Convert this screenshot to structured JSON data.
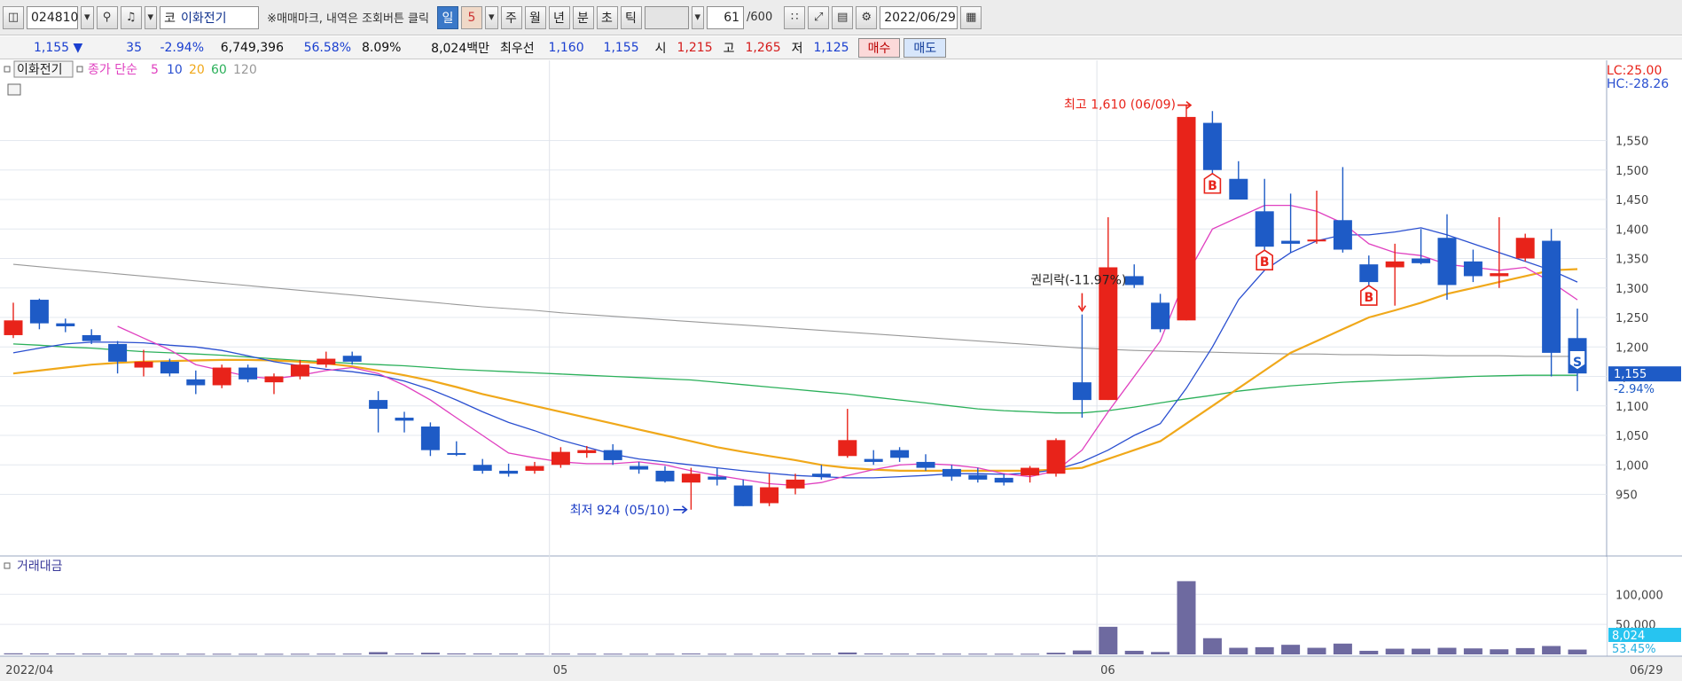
{
  "toolbar": {
    "code": "024810",
    "market_tag": "코",
    "stock_name": "이화전기",
    "hint": "※매매마크, 내역은 조회버튼 클릭",
    "periods": [
      "일",
      "5",
      "주",
      "월",
      "년",
      "분",
      "초",
      "틱"
    ],
    "active_period": "일",
    "selected_period": "5",
    "count": "61",
    "total": "/600",
    "date": "2022/06/29",
    "icons": [
      "chart-type-icon",
      "search-icon",
      "sound-icon",
      "scatter-icon",
      "compare-icon",
      "save-icon",
      "settings-icon",
      "calendar-icon"
    ]
  },
  "quote": {
    "price": "1,155 ▼",
    "change": "35",
    "change_pct": "-2.94%",
    "volume": "6,749,396",
    "vol_ratio": "56.58%",
    "turnover_pct": "8.09%",
    "amount": "8,024백만",
    "best_bid_label": "최우선",
    "best_ask": "1,160",
    "best_bid": "1,155",
    "open_label": "시",
    "open": "1,215",
    "high_label": "고",
    "high": "1,265",
    "low_label": "저",
    "low": "1,125",
    "buy_label": "매수",
    "sell_label": "매도"
  },
  "colors": {
    "up": "#e8231a",
    "down": "#1e5bc6",
    "ma5": "#e040c0",
    "ma10": "#2a4fd0",
    "ma20": "#f0a81a",
    "ma60": "#2bb05a",
    "ma120": "#999999",
    "volume_bar": "#6e6aa0"
  },
  "chart_data": {
    "type": "candlestick",
    "legend": {
      "name": "이화전기",
      "ma_label": "종가 단순",
      "ma_periods": [
        "5",
        "10",
        "20",
        "60",
        "120"
      ]
    },
    "right_labels": {
      "lc": "LC:25.00",
      "hc": "HC:-28.26"
    },
    "ylim": [
      850,
      1650
    ],
    "y_ticks": [
      950,
      1000,
      1050,
      1100,
      1150,
      1200,
      1250,
      1300,
      1350,
      1400,
      1450,
      1500,
      1550
    ],
    "y_tick_labels": [
      "950",
      "1,000",
      "1,050",
      "1,100",
      "1,150",
      "1,200",
      "1,250",
      "1,300",
      "1,350",
      "1,400",
      "1,450",
      "1,500",
      "1,550"
    ],
    "x_labels": [
      {
        "label": "2022/04",
        "index": 0
      },
      {
        "label": "05",
        "index": 21
      },
      {
        "label": "06",
        "index": 42
      }
    ],
    "last_x_label": "06/29",
    "candles": [
      {
        "o": 1220,
        "h": 1275,
        "l": 1215,
        "c": 1245
      },
      {
        "o": 1280,
        "h": 1282,
        "l": 1230,
        "c": 1240
      },
      {
        "o": 1240,
        "h": 1248,
        "l": 1225,
        "c": 1235
      },
      {
        "o": 1220,
        "h": 1230,
        "l": 1205,
        "c": 1210
      },
      {
        "o": 1205,
        "h": 1210,
        "l": 1155,
        "c": 1175
      },
      {
        "o": 1165,
        "h": 1195,
        "l": 1150,
        "c": 1175
      },
      {
        "o": 1175,
        "h": 1180,
        "l": 1150,
        "c": 1155
      },
      {
        "o": 1145,
        "h": 1160,
        "l": 1120,
        "c": 1135
      },
      {
        "o": 1135,
        "h": 1170,
        "l": 1130,
        "c": 1165
      },
      {
        "o": 1165,
        "h": 1170,
        "l": 1140,
        "c": 1145
      },
      {
        "o": 1140,
        "h": 1155,
        "l": 1120,
        "c": 1150
      },
      {
        "o": 1150,
        "h": 1178,
        "l": 1145,
        "c": 1170
      },
      {
        "o": 1170,
        "h": 1192,
        "l": 1165,
        "c": 1180
      },
      {
        "o": 1185,
        "h": 1192,
        "l": 1170,
        "c": 1175
      },
      {
        "o": 1110,
        "h": 1125,
        "l": 1055,
        "c": 1095
      },
      {
        "o": 1080,
        "h": 1090,
        "l": 1055,
        "c": 1075
      },
      {
        "o": 1065,
        "h": 1072,
        "l": 1015,
        "c": 1025
      },
      {
        "o": 1020,
        "h": 1040,
        "l": 1015,
        "c": 1018
      },
      {
        "o": 1000,
        "h": 1010,
        "l": 985,
        "c": 990
      },
      {
        "o": 990,
        "h": 1002,
        "l": 980,
        "c": 985
      },
      {
        "o": 990,
        "h": 1005,
        "l": 985,
        "c": 998
      },
      {
        "o": 1000,
        "h": 1030,
        "l": 995,
        "c": 1022
      },
      {
        "o": 1020,
        "h": 1032,
        "l": 1012,
        "c": 1025
      },
      {
        "o": 1025,
        "h": 1035,
        "l": 1000,
        "c": 1008
      },
      {
        "o": 998,
        "h": 1005,
        "l": 985,
        "c": 992
      },
      {
        "o": 990,
        "h": 998,
        "l": 970,
        "c": 972
      },
      {
        "o": 970,
        "h": 995,
        "l": 924,
        "c": 985
      },
      {
        "o": 980,
        "h": 995,
        "l": 965,
        "c": 975
      },
      {
        "o": 965,
        "h": 975,
        "l": 930,
        "c": 930
      },
      {
        "o": 935,
        "h": 985,
        "l": 930,
        "c": 962
      },
      {
        "o": 960,
        "h": 985,
        "l": 950,
        "c": 975
      },
      {
        "o": 985,
        "h": 1000,
        "l": 975,
        "c": 980
      },
      {
        "o": 1015,
        "h": 1095,
        "l": 1012,
        "c": 1042
      },
      {
        "o": 1010,
        "h": 1025,
        "l": 1000,
        "c": 1005
      },
      {
        "o": 1025,
        "h": 1030,
        "l": 1005,
        "c": 1012
      },
      {
        "o": 1005,
        "h": 1018,
        "l": 990,
        "c": 995
      },
      {
        "o": 993,
        "h": 1000,
        "l": 973,
        "c": 980
      },
      {
        "o": 983,
        "h": 995,
        "l": 970,
        "c": 975
      },
      {
        "o": 978,
        "h": 985,
        "l": 965,
        "c": 970
      },
      {
        "o": 982,
        "h": 998,
        "l": 970,
        "c": 995
      },
      {
        "o": 985,
        "h": 1045,
        "l": 980,
        "c": 1042
      },
      {
        "o": 1140,
        "h": 1255,
        "l": 1080,
        "c": 1110
      },
      {
        "o": 1110,
        "h": 1420,
        "l": 1110,
        "c": 1335
      },
      {
        "o": 1320,
        "h": 1340,
        "l": 1300,
        "c": 1305
      },
      {
        "o": 1275,
        "h": 1290,
        "l": 1225,
        "c": 1230
      },
      {
        "o": 1245,
        "h": 1610,
        "l": 1245,
        "c": 1590
      },
      {
        "o": 1580,
        "h": 1600,
        "l": 1480,
        "c": 1500
      },
      {
        "o": 1485,
        "h": 1515,
        "l": 1450,
        "c": 1450
      },
      {
        "o": 1430,
        "h": 1485,
        "l": 1360,
        "c": 1370
      },
      {
        "o": 1380,
        "h": 1460,
        "l": 1360,
        "c": 1375
      },
      {
        "o": 1380,
        "h": 1465,
        "l": 1375,
        "c": 1382
      },
      {
        "o": 1415,
        "h": 1505,
        "l": 1360,
        "c": 1365
      },
      {
        "o": 1340,
        "h": 1355,
        "l": 1300,
        "c": 1310
      },
      {
        "o": 1335,
        "h": 1375,
        "l": 1270,
        "c": 1345
      },
      {
        "o": 1350,
        "h": 1400,
        "l": 1340,
        "c": 1342
      },
      {
        "o": 1385,
        "h": 1425,
        "l": 1280,
        "c": 1305
      },
      {
        "o": 1345,
        "h": 1365,
        "l": 1310,
        "c": 1320
      },
      {
        "o": 1320,
        "h": 1420,
        "l": 1300,
        "c": 1325
      },
      {
        "o": 1350,
        "h": 1392,
        "l": 1345,
        "c": 1385
      },
      {
        "o": 1380,
        "h": 1400,
        "l": 1150,
        "c": 1190
      },
      {
        "o": 1215,
        "h": 1265,
        "l": 1125,
        "c": 1155
      }
    ],
    "ma_series": [
      {
        "period": "5",
        "values": [
          null,
          null,
          null,
          null,
          1235,
          1215,
          1195,
          1170,
          1160,
          1150,
          1146,
          1152,
          1160,
          1165,
          1155,
          1135,
          1110,
          1080,
          1050,
          1020,
          1012,
          1005,
          1002,
          1002,
          1005,
          1000,
          990,
          982,
          975,
          968,
          965,
          970,
          982,
          992,
          1000,
          1002,
          1000,
          995,
          985,
          980,
          990,
          1025,
          1090,
          1150,
          1210,
          1320,
          1400,
          1420,
          1440,
          1440,
          1430,
          1410,
          1375,
          1360,
          1355,
          1340,
          1335,
          1330,
          1335,
          1310,
          1280
        ]
      },
      {
        "period": "10",
        "values": [
          1190,
          1198,
          1205,
          1208,
          1208,
          1207,
          1203,
          1200,
          1194,
          1185,
          1175,
          1168,
          1162,
          1158,
          1152,
          1142,
          1128,
          1110,
          1090,
          1072,
          1058,
          1042,
          1030,
          1018,
          1010,
          1005,
          1000,
          995,
          990,
          986,
          982,
          980,
          978,
          978,
          980,
          982,
          985,
          985,
          984,
          986,
          992,
          1005,
          1025,
          1050,
          1070,
          1130,
          1200,
          1280,
          1330,
          1360,
          1380,
          1390,
          1390,
          1395,
          1402,
          1390,
          1375,
          1360,
          1345,
          1330,
          1310
        ]
      },
      {
        "period": "20",
        "values": [
          1155,
          1160,
          1165,
          1170,
          1173,
          1175,
          1176,
          1177,
          1178,
          1178,
          1177,
          1175,
          1172,
          1167,
          1160,
          1152,
          1143,
          1132,
          1120,
          1110,
          1100,
          1090,
          1080,
          1070,
          1060,
          1050,
          1040,
          1030,
          1022,
          1015,
          1008,
          1000,
          995,
          992,
          990,
          990,
          990,
          990,
          990,
          990,
          992,
          995,
          1010,
          1025,
          1040,
          1070,
          1100,
          1130,
          1160,
          1190,
          1210,
          1230,
          1250,
          1262,
          1275,
          1290,
          1300,
          1310,
          1320,
          1330,
          1332
        ]
      },
      {
        "period": "60",
        "values": [
          1205,
          1203,
          1200,
          1198,
          1195,
          1192,
          1190,
          1188,
          1186,
          1183,
          1180,
          1177,
          1175,
          1172,
          1170,
          1168,
          1165,
          1162,
          1160,
          1158,
          1156,
          1154,
          1152,
          1150,
          1148,
          1146,
          1144,
          1140,
          1136,
          1132,
          1128,
          1124,
          1120,
          1115,
          1110,
          1105,
          1100,
          1095,
          1092,
          1090,
          1088,
          1088,
          1092,
          1098,
          1105,
          1112,
          1118,
          1125,
          1130,
          1134,
          1137,
          1140,
          1142,
          1144,
          1146,
          1148,
          1150,
          1151,
          1152,
          1152,
          1152
        ]
      },
      {
        "period": "120",
        "values": [
          1340,
          1336,
          1332,
          1328,
          1324,
          1320,
          1316,
          1312,
          1308,
          1304,
          1300,
          1296,
          1292,
          1288,
          1284,
          1280,
          1276,
          1272,
          1268,
          1265,
          1262,
          1258,
          1255,
          1252,
          1249,
          1246,
          1243,
          1240,
          1237,
          1234,
          1231,
          1228,
          1225,
          1222,
          1219,
          1216,
          1213,
          1210,
          1207,
          1204,
          1201,
          1198,
          1196,
          1194,
          1193,
          1192,
          1191,
          1190,
          1189,
          1188,
          1188,
          1187,
          1187,
          1186,
          1186,
          1185,
          1185,
          1185,
          1184,
          1184,
          1184
        ]
      }
    ],
    "annotations": {
      "high": {
        "label": "최고 1,610 (06/09)",
        "index": 45,
        "value": 1610
      },
      "low": {
        "label": "최저 924 (05/10)",
        "index": 26,
        "value": 924
      },
      "rights": {
        "label": "권리락(-11.97%)",
        "index": 41
      }
    },
    "trade_marks": [
      {
        "label": "B",
        "index": 46
      },
      {
        "label": "B",
        "index": 48
      },
      {
        "label": "B",
        "index": 52
      },
      {
        "label": "S",
        "index": 60
      }
    ],
    "current_price": {
      "label": "1,155",
      "pct": "-2.94%",
      "value": 1155
    },
    "volume_panel": {
      "title": "거래대금",
      "ylim": [
        0,
        130000
      ],
      "y_ticks": [
        50000,
        100000
      ],
      "y_tick_labels": [
        "50,000",
        "100,000"
      ],
      "current_label": "8,024",
      "current_pct": "53.45%",
      "values": [
        1800,
        1600,
        1500,
        1400,
        1300,
        1200,
        1200,
        1100,
        1100,
        1000,
        1000,
        1100,
        1200,
        1300,
        3800,
        1500,
        2800,
        1600,
        1500,
        1400,
        1300,
        1300,
        1200,
        1200,
        1100,
        1100,
        1500,
        1100,
        1100,
        1200,
        1400,
        1400,
        3200,
        1500,
        1300,
        1400,
        1200,
        1200,
        1100,
        1100,
        2800,
        6500,
        46000,
        6000,
        4000,
        122000,
        27000,
        11000,
        12000,
        16000,
        11000,
        18000,
        6000,
        9500,
        9500,
        11000,
        10000,
        8500,
        10500,
        14000,
        8024
      ]
    }
  }
}
